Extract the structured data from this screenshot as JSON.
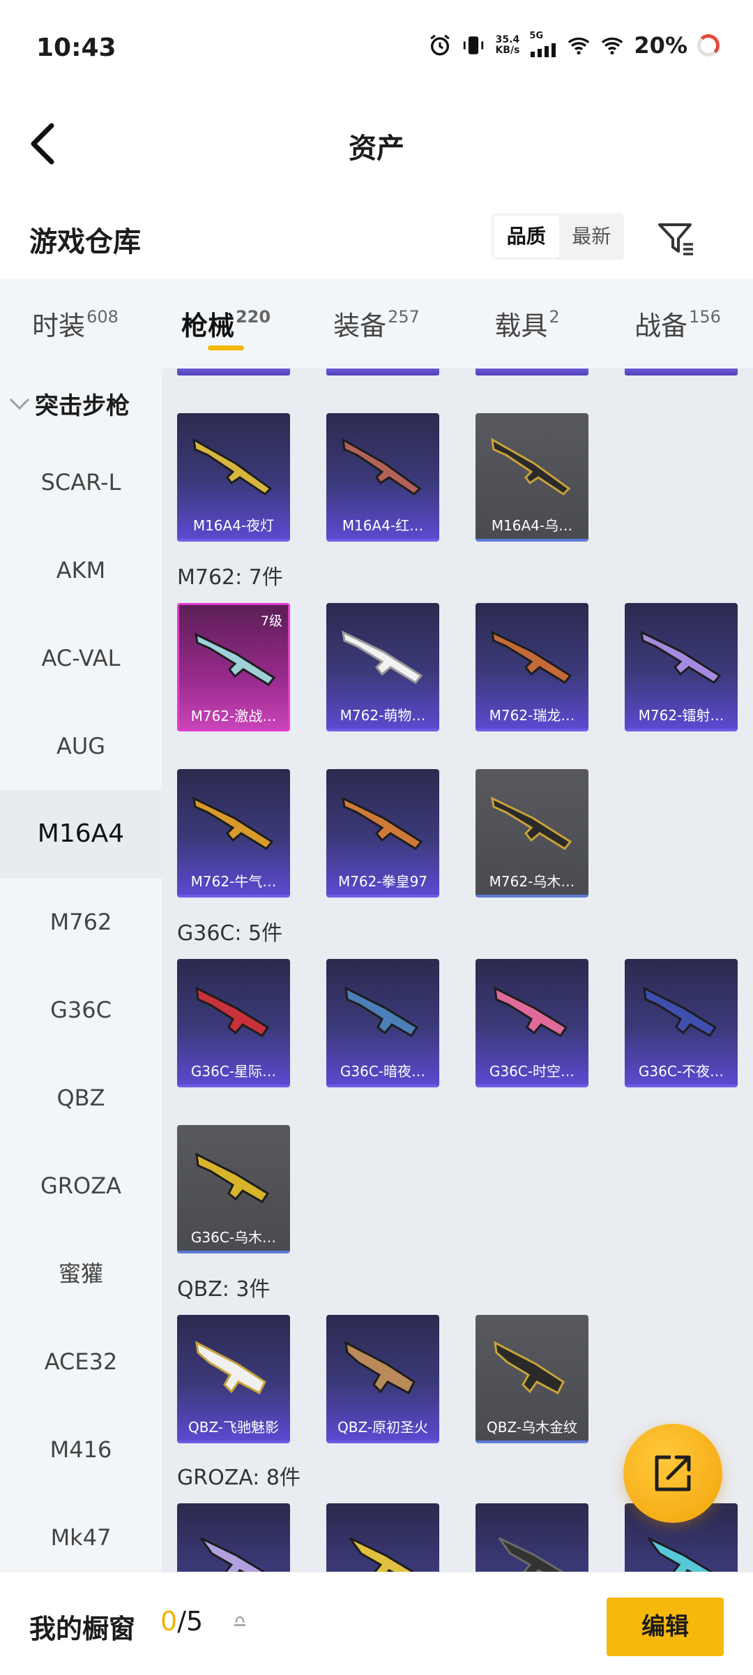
{
  "status": {
    "time": "10:43",
    "net_speed_top": "35.4",
    "net_speed_bottom": "KB/s",
    "net_type": "5G",
    "battery": "20%"
  },
  "header": {
    "title": "资产"
  },
  "warehouse": {
    "title": "游戏仓库",
    "sort_options": [
      "品质",
      "最新"
    ]
  },
  "tabs": [
    {
      "label": "时装",
      "count": "608"
    },
    {
      "label": "枪械",
      "count": "220"
    },
    {
      "label": "装备",
      "count": "257"
    },
    {
      "label": "载具",
      "count": "2"
    },
    {
      "label": "战备",
      "count": "156"
    }
  ],
  "sidebar": {
    "category": "突击步枪",
    "items": [
      "SCAR-L",
      "AKM",
      "AC-VAL",
      "AUG",
      "M16A4",
      "M762",
      "G36C",
      "QBZ",
      "GROZA",
      "蜜獾",
      "ACE32",
      "M416",
      "Mk47"
    ]
  },
  "groups": {
    "m16": {
      "items": [
        "M16A4-夜灯",
        "M16A4-红…",
        "M16A4-乌…"
      ]
    },
    "m762": {
      "title": "M762: 7件",
      "level": "7级",
      "items": [
        "M762-激战…",
        "M762-萌物…",
        "M762-瑞龙…",
        "M762-镭射…",
        "M762-牛气…",
        "M762-拳皇97",
        "M762-乌木…"
      ]
    },
    "g36c": {
      "title": "G36C: 5件",
      "items": [
        "G36C-星际…",
        "G36C-暗夜…",
        "G36C-时空…",
        "G36C-不夜…",
        "G36C-乌木…"
      ]
    },
    "qbz": {
      "title": "QBZ: 3件",
      "items": [
        "QBZ-飞驰魅影",
        "QBZ-原初圣火",
        "QBZ-乌木金纹"
      ]
    },
    "groza": {
      "title": "GROZA: 8件"
    }
  },
  "bottom": {
    "label": "我的橱窗",
    "count_current": "0",
    "count_total": "/5",
    "edit_label": "编辑"
  },
  "colors": {
    "accent": "#f6b80b",
    "epic_purple": "#6e5be6",
    "legend_pink": "#e23bd0"
  }
}
